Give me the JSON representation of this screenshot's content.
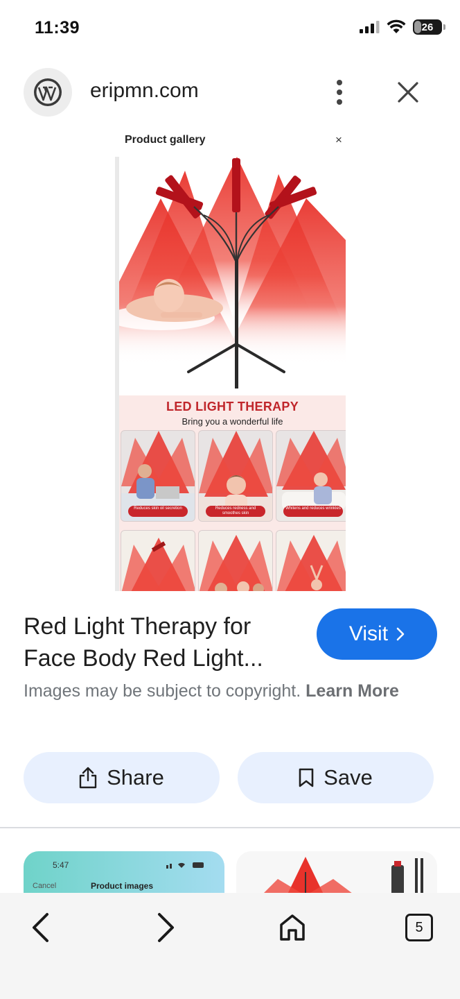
{
  "status": {
    "time": "11:39",
    "battery": "26",
    "battery_level": 0.26
  },
  "header": {
    "domain": "eripmn.com",
    "logo_icon": "wordpress-icon"
  },
  "gallery": {
    "title": "Product gallery",
    "close_glyph": "×",
    "banner_title": "LED LIGHT THERAPY",
    "banner_subtitle": "Bring you a wonderful life",
    "tiles": [
      {
        "caption": "Reduces skin oil secretion"
      },
      {
        "caption": "Reduces redness and smoothes skin"
      },
      {
        "caption": "Whitens and reduces wrinkles"
      }
    ]
  },
  "result": {
    "title": "Red Light Therapy for Face Body Red Light...",
    "visit_label": "Visit",
    "copyright_text": "Images may be subject to copyright.",
    "learn_more": "Learn More"
  },
  "actions": {
    "share_label": "Share",
    "save_label": "Save"
  },
  "related": {
    "left_time": "5:47",
    "left_cancel": "Cancel",
    "left_title": "Product images"
  },
  "nav": {
    "tab_count": "5"
  },
  "colors": {
    "accent": "#1a73e8",
    "action_bg": "#e8f0fe",
    "banner_red": "#c0262b"
  }
}
